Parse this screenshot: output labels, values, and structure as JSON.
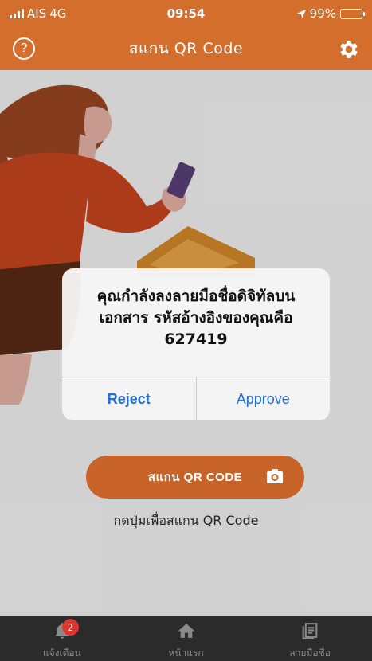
{
  "status_bar": {
    "carrier": "AIS",
    "network": "4G",
    "time": "09:54",
    "battery_text": "99%",
    "battery_level": 0.99
  },
  "header": {
    "title": "สแกน QR Code",
    "help_glyph": "?",
    "help_icon": "help-circle-icon",
    "settings_icon": "gear-icon"
  },
  "main": {
    "scan_button_label": "สแกน QR CODE",
    "scan_button_icon": "camera-icon",
    "hint": "กดปุ่มเพื่อสแกน QR Code"
  },
  "dialog": {
    "message_line1": "คุณกำลังลงลายมือชื่อดิจิทัลบน",
    "message_line2": "เอกสาร รหัสอ้างอิงของคุณคือ",
    "reference_code": "627419",
    "reject_label": "Reject",
    "approve_label": "Approve"
  },
  "tab_bar": {
    "tabs": [
      {
        "label": "แจ้งเตือน",
        "icon": "bell-icon",
        "badge": "2"
      },
      {
        "label": "หน้าแรก",
        "icon": "home-icon"
      },
      {
        "label": "ลายมือชื่อ",
        "icon": "document-list-icon"
      }
    ]
  },
  "colors": {
    "brand_orange": "#d46e2d",
    "button_orange": "#c8642a",
    "link_blue": "#1f6fd6",
    "tabbar_bg": "#2b2b2b",
    "badge_red": "#e0342c"
  }
}
